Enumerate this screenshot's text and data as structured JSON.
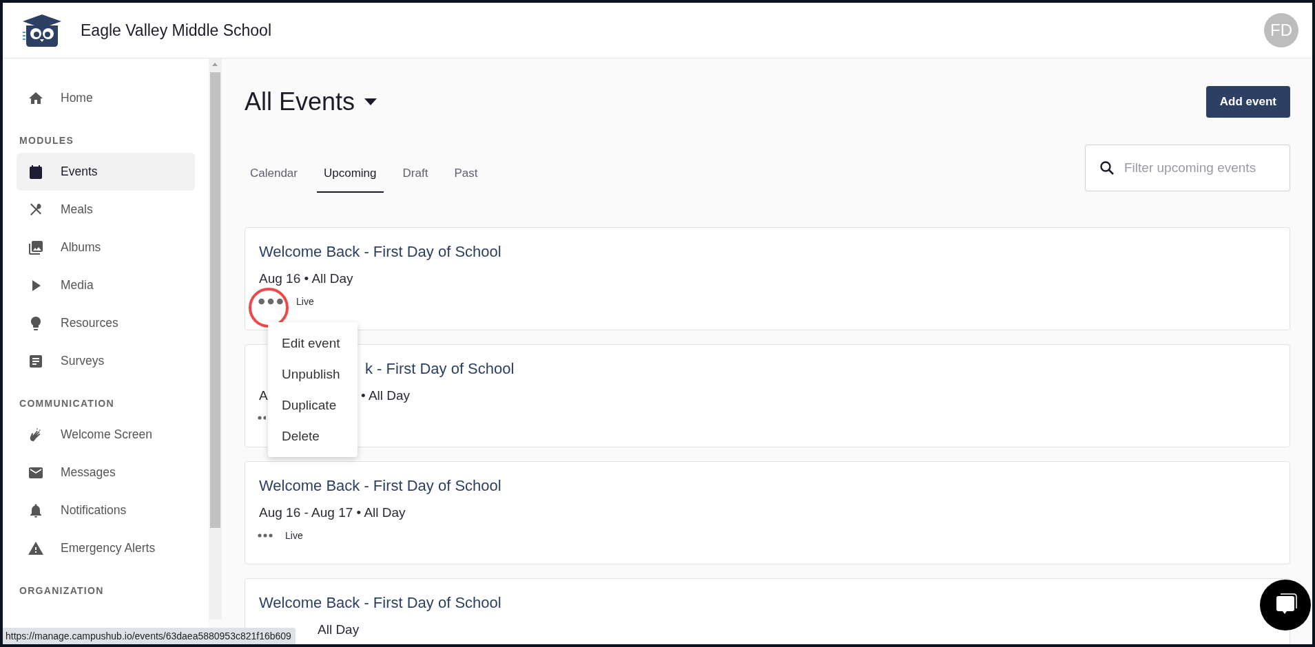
{
  "header": {
    "school_name": "Eagle Valley Middle School",
    "avatar_initials": "FD"
  },
  "sidebar": {
    "home": {
      "label": "Home",
      "selected": false
    },
    "sections": [
      {
        "heading": "MODULES",
        "items": [
          {
            "label": "Events",
            "selected": true
          },
          {
            "label": "Meals",
            "selected": false
          },
          {
            "label": "Albums",
            "selected": false
          },
          {
            "label": "Media",
            "selected": false
          },
          {
            "label": "Resources",
            "selected": false
          },
          {
            "label": "Surveys",
            "selected": false
          }
        ]
      },
      {
        "heading": "COMMUNICATION",
        "items": [
          {
            "label": "Welcome Screen",
            "selected": false
          },
          {
            "label": "Messages",
            "selected": false
          },
          {
            "label": "Notifications",
            "selected": false
          },
          {
            "label": "Emergency Alerts",
            "selected": false
          }
        ]
      },
      {
        "heading": "ORGANIZATION"
      }
    ]
  },
  "page": {
    "title": "All Events",
    "add_button": "Add event"
  },
  "tabs": [
    {
      "label": "Calendar",
      "selected": false
    },
    {
      "label": "Upcoming",
      "selected": true
    },
    {
      "label": "Draft",
      "selected": false
    },
    {
      "label": "Past",
      "selected": false
    }
  ],
  "search": {
    "placeholder": "Filter upcoming events"
  },
  "events": [
    {
      "kind": "plain",
      "title": "Welcome Back - First Day of School",
      "date": "Aug 16 • All Day",
      "status": "Live",
      "menu_open": true
    },
    {
      "kind": "under_menu",
      "title": "k - First Day of School",
      "date_parts": [
        "A",
        "• All Day"
      ]
    },
    {
      "kind": "plain",
      "title": "Welcome Back - First Day of School",
      "date": "Aug 16 - Aug 17 • All Day",
      "status": "Live",
      "menu_open": false
    },
    {
      "kind": "under_tooltip",
      "title": "Welcome Back - First Day of School",
      "date": "All Day"
    }
  ],
  "event_menu": [
    "Edit event",
    "Unpublish",
    "Duplicate",
    "Delete"
  ],
  "status_url": "https://manage.campushub.io/events/63daea5880953c821f16b609"
}
